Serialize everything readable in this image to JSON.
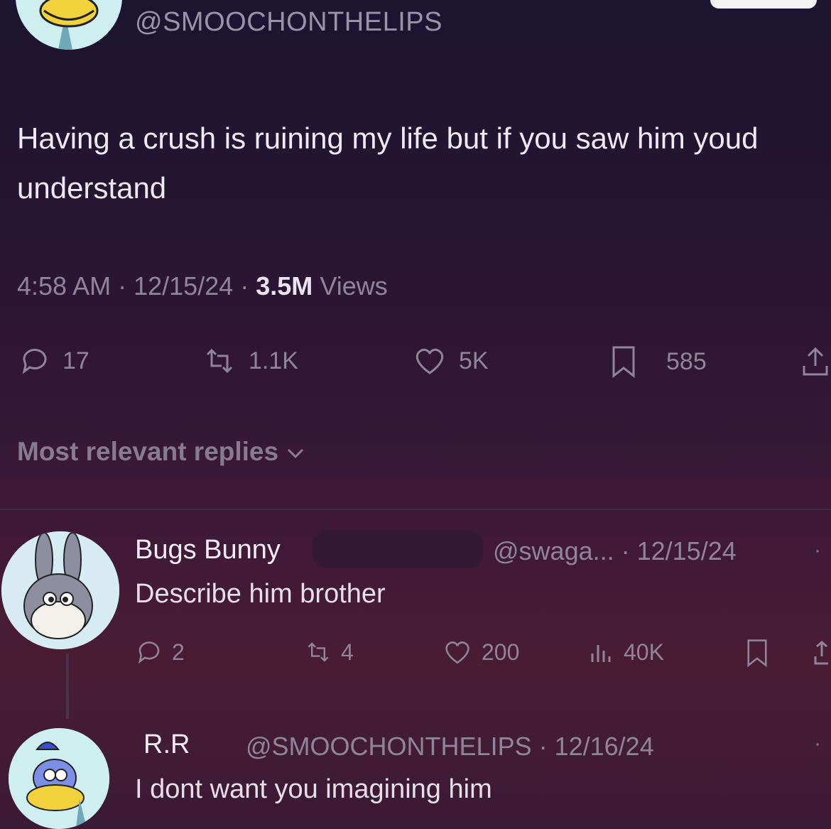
{
  "tweet": {
    "handle": "@SMOOCHONTHELIPS",
    "text": "Having a crush is ruining my life but if you saw him youd understand",
    "time": "4:58 AM",
    "date": "12/15/24",
    "views_count": "3.5M",
    "views_label": "Views",
    "stats": {
      "replies": "17",
      "reposts": "1.1K",
      "likes": "5K",
      "bookmarks": "585"
    }
  },
  "replies_header": "Most relevant replies",
  "reply1": {
    "name": "Bugs Bunny",
    "handle_date": "@swaga... · 12/15/24",
    "text": "Describe him brother",
    "stats": {
      "replies": "2",
      "reposts": "4",
      "likes": "200",
      "views": "40K"
    }
  },
  "reply2": {
    "name": "R.R",
    "handle_date": "@SMOOCHONTHELIPS · 12/16/24",
    "text": "I dont want you imagining him"
  },
  "icons": [
    "reply-icon",
    "repost-icon",
    "like-icon",
    "bookmark-icon",
    "share-icon",
    "views-icon",
    "chevron-down-icon"
  ]
}
